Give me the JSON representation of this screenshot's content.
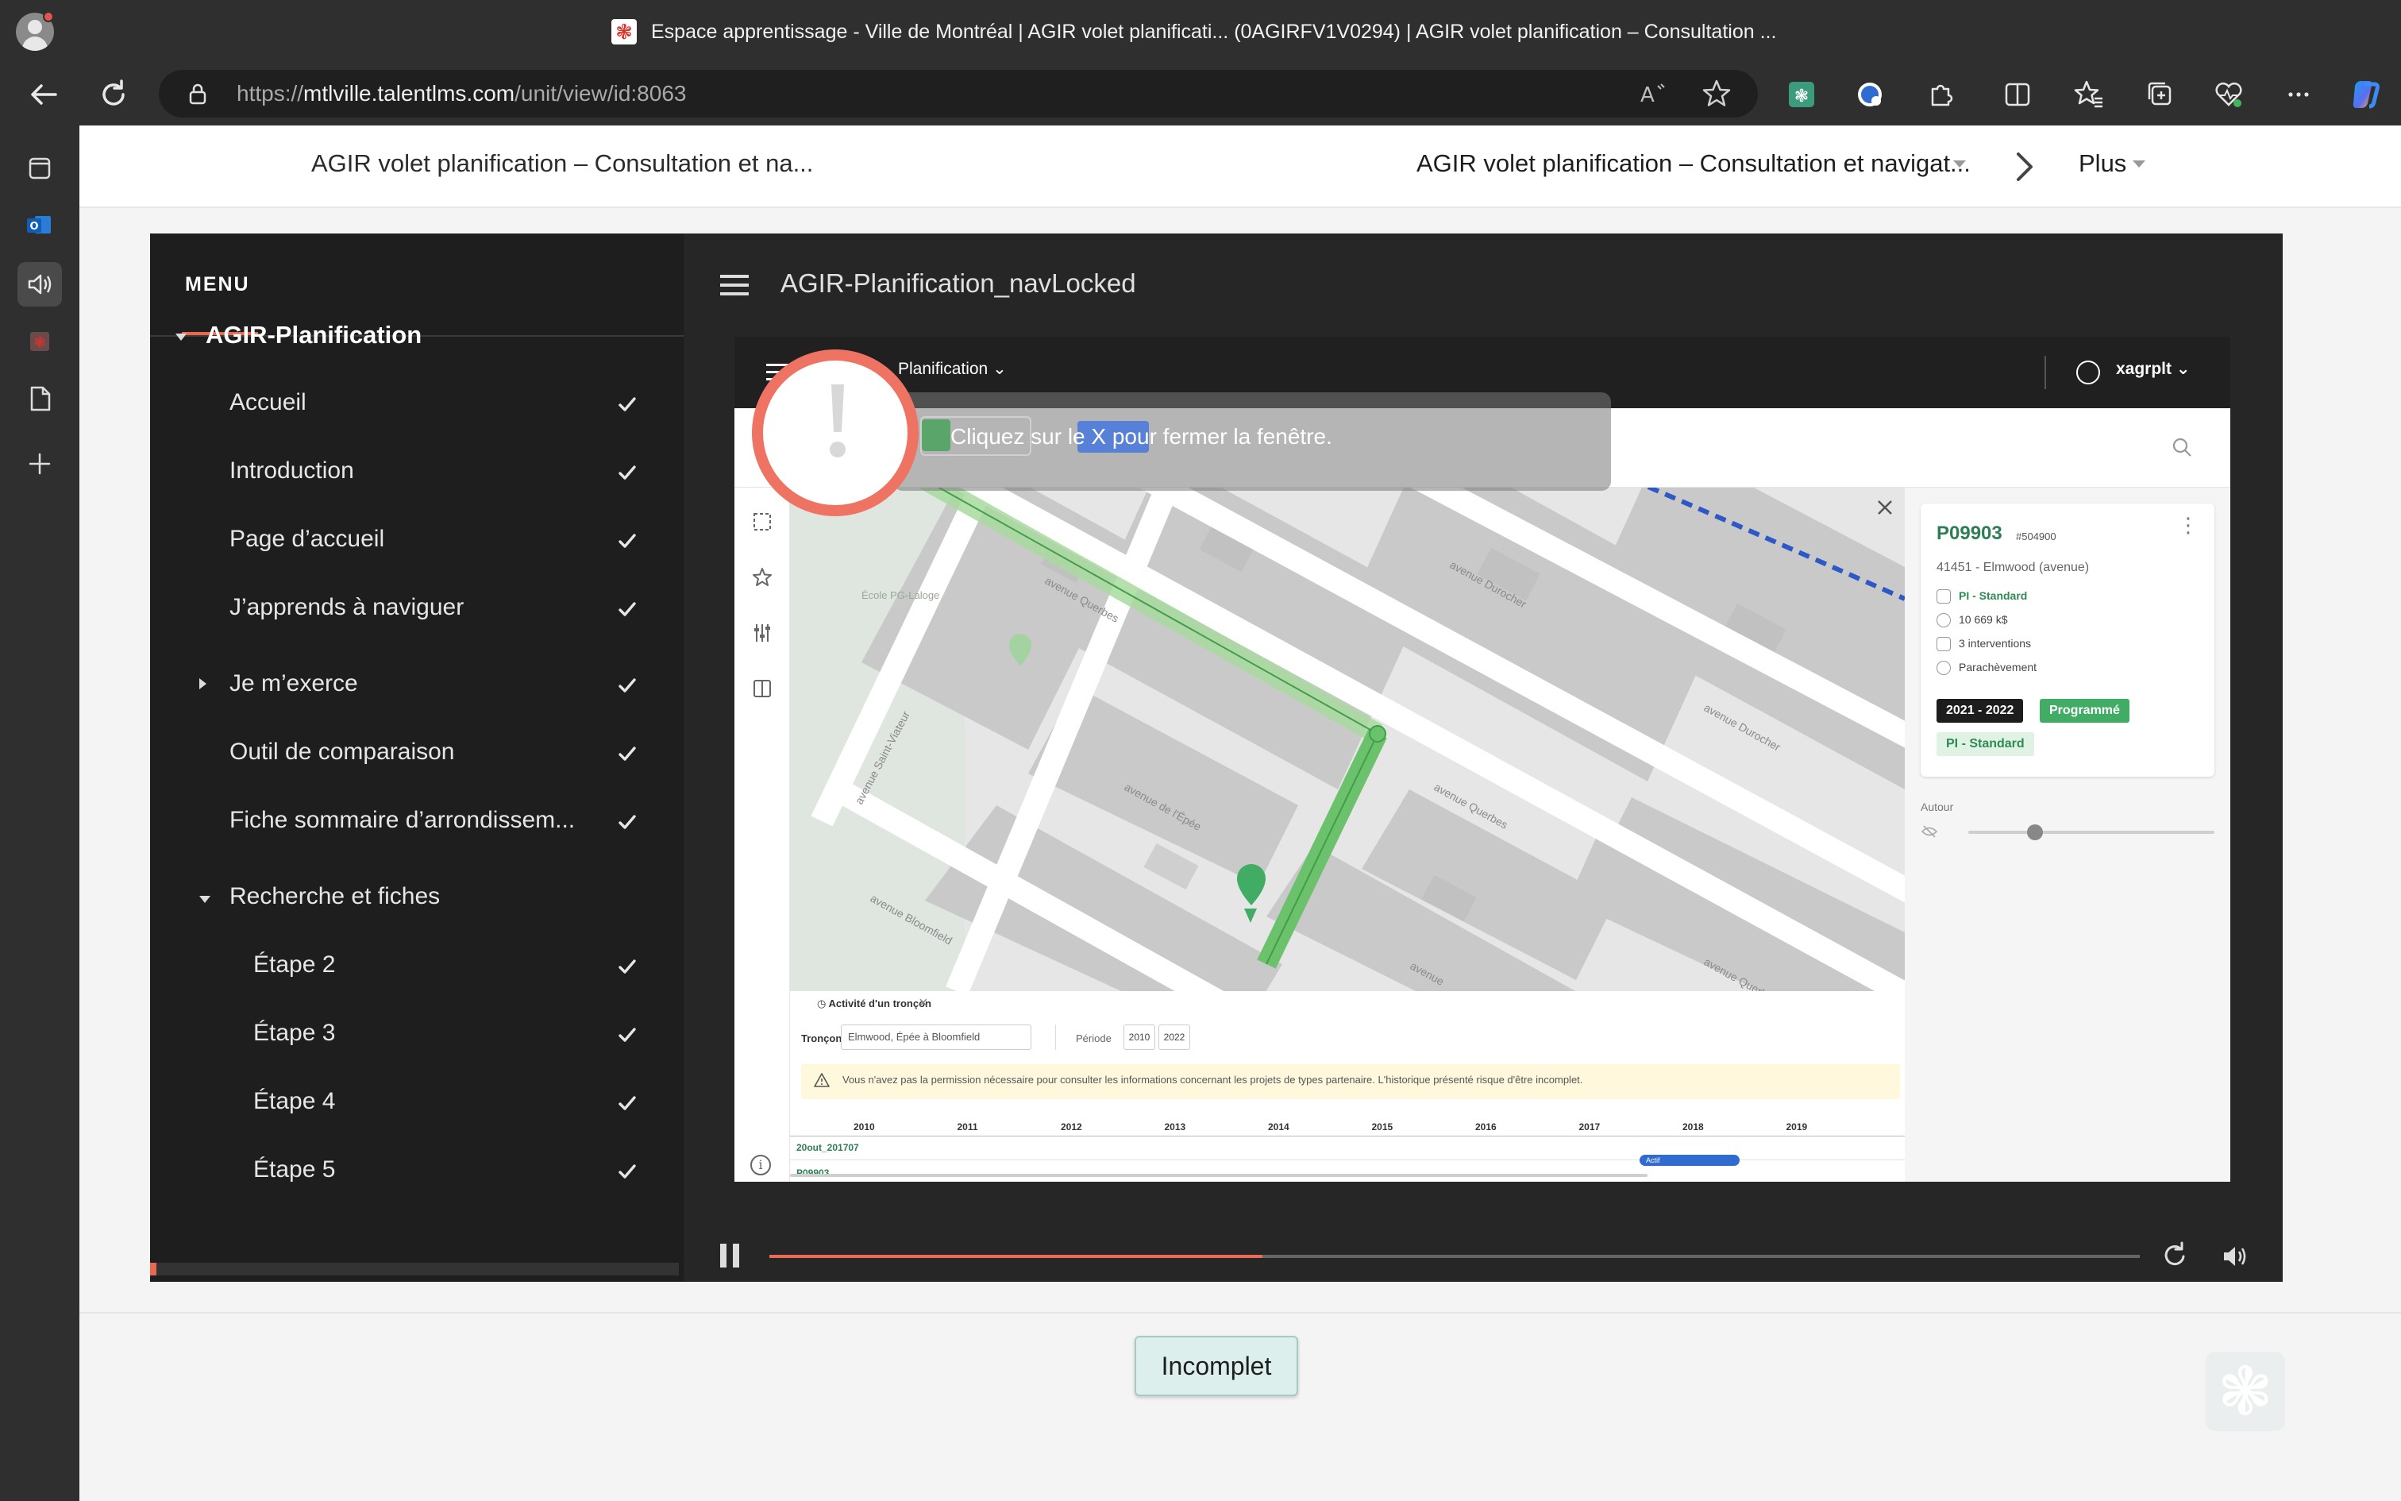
{
  "browser": {
    "window_title": "Espace apprentissage - Ville de Montréal | AGIR volet planificati... (0AGIRFV1V0294) | AGIR volet planification – Consultation ...",
    "url_scheme": "https://",
    "url_host": "mtlville.talentlms.com",
    "url_path": "/unit/view/id:8063",
    "icons": [
      "back-icon",
      "refresh-icon",
      "lock-icon",
      "read-aloud-icon",
      "favorite-star-icon",
      "extension-icons",
      "split-screen-icon",
      "favorites-icon",
      "collections-icon",
      "health-icon",
      "more-icon",
      "copilot-icon"
    ]
  },
  "course_header": {
    "course_title": "AGIR volet planification – Consultation et na...",
    "unit_select": "AGIR volet planification – Consultation et navigat...",
    "more_label": "Plus"
  },
  "menu": {
    "heading": "MENU",
    "progress_fraction": 0.012,
    "items": [
      {
        "label": "AGIR-Planification",
        "level": 0,
        "caret": "down",
        "check": false
      },
      {
        "label": "Accueil",
        "level": 1,
        "check": true
      },
      {
        "label": "Introduction",
        "level": 1,
        "check": true
      },
      {
        "label": "Page d’accueil",
        "level": 1,
        "check": true
      },
      {
        "label": "J’apprends à naviguer",
        "level": 1,
        "check": true
      },
      {
        "label": "Je m’exerce",
        "level": 1,
        "caret": "right",
        "check": true
      },
      {
        "label": "Outil de comparaison",
        "level": 1,
        "check": true
      },
      {
        "label": "Fiche sommaire d’arrondissem...",
        "level": 1,
        "check": true
      },
      {
        "label": "Recherche et fiches",
        "level": 1,
        "caret": "down",
        "check": false
      },
      {
        "label": "Étape 2",
        "level": 2,
        "check": true
      },
      {
        "label": "Étape 3",
        "level": 2,
        "check": true
      },
      {
        "label": "Étape 4",
        "level": 2,
        "check": true
      },
      {
        "label": "Étape 5",
        "level": 2,
        "check": true
      }
    ]
  },
  "slide": {
    "title": "AGIR-Planification_navLocked",
    "app": {
      "module_label": "Planification",
      "user": "xagrplt",
      "tooltip": "Cliquez sur le X pour fermer la fenêtre.",
      "map_streets": [
        "avenue Querbes",
        "avenue Durocher",
        "avenue Durocher",
        "avenue Querbes",
        "avenue Querbes",
        "avenue de l'Épée",
        "avenue Saint-Viateur",
        "avenue Bloomfield",
        "avenue",
        "École PG-Laloge"
      ],
      "info_card": {
        "id": "P09903",
        "subid": "#504900",
        "address": "41451 - Elmwood (avenue)",
        "category": "PI - Standard",
        "cost": "10 669 k$",
        "interventions": "3 interventions",
        "status": "Parachèvement",
        "tag_years": "2021 - 2022",
        "tag_program": "Programmé",
        "tag_standard": "PI - Standard"
      },
      "autour_label": "Autour",
      "autour_level": 0.27,
      "activity": {
        "title": "Activité d'un tronçon",
        "troncon_label": "Tronçon",
        "troncon_value": "Elmwood, Épée à Bloomfield",
        "periode_label": "Période",
        "period_start": "2010",
        "period_end": "2022",
        "warning": "Vous n'avez pas la permission nécessaire pour consulter les informations concernant les projets de types partenaire. L'historique présenté risque d'être incomplet.",
        "years": [
          "2010",
          "2011",
          "2012",
          "2013",
          "2014",
          "2015",
          "2016",
          "2017",
          "2018",
          "2019"
        ],
        "rows": [
          "20out_201707",
          "P09903"
        ],
        "bar_label": "Actif"
      }
    },
    "playback_fraction": 0.36
  },
  "status_button": "Incomplet",
  "colors": {
    "accent": "#ee6a55",
    "map_green": "#41ad64",
    "dark": "#1e1e1e"
  }
}
